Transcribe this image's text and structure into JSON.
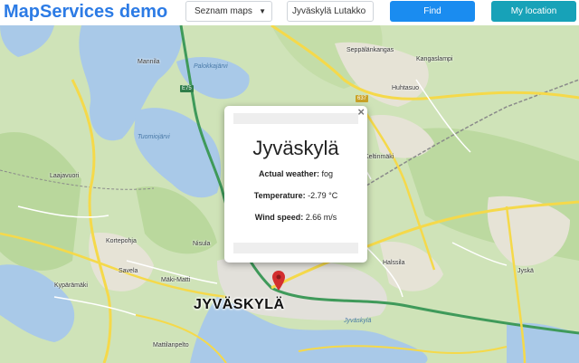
{
  "header": {
    "brand": "MapServices demo",
    "map_select": {
      "selected": "Seznam maps"
    },
    "search": {
      "value": "Jyväskylä Lutakko J"
    },
    "find_label": "Find",
    "location_label": "My location"
  },
  "map": {
    "places": [
      "Seppälänkangas",
      "Kangaslampi",
      "Huhtasuo",
      "Mannila",
      "Laajavuori",
      "Kortepohja",
      "Savela",
      "Kypärämäki",
      "Mäki-Matti",
      "Nisula",
      "Halssila",
      "Jyskä",
      "Mattilanpelto",
      "Keltinmäki"
    ],
    "waters": [
      "Palokkajärvi",
      "Tuomiojärvi",
      "Jyväskylä"
    ],
    "roads": [
      "E75",
      "637"
    ],
    "city_label": "JYVÄSKYLÄ",
    "colors": {
      "land": "#cfe3b8",
      "forest": "#b7d49a",
      "water": "#a9c9e8",
      "urban": "#e2e0da",
      "major_road": "#f5d94a",
      "rail": "#8a8a8a"
    }
  },
  "popup": {
    "title": "Jyväskylä",
    "weather_label": "Actual weather:",
    "weather_value": "fog",
    "temperature_label": "Temperature:",
    "temperature_value": "-2.79 °C",
    "wind_label": "Wind speed:",
    "wind_value": "2.66 m/s",
    "close_icon": "close-icon"
  },
  "marker": {
    "icon": "map-pin-icon",
    "color": "#d32f2f"
  }
}
